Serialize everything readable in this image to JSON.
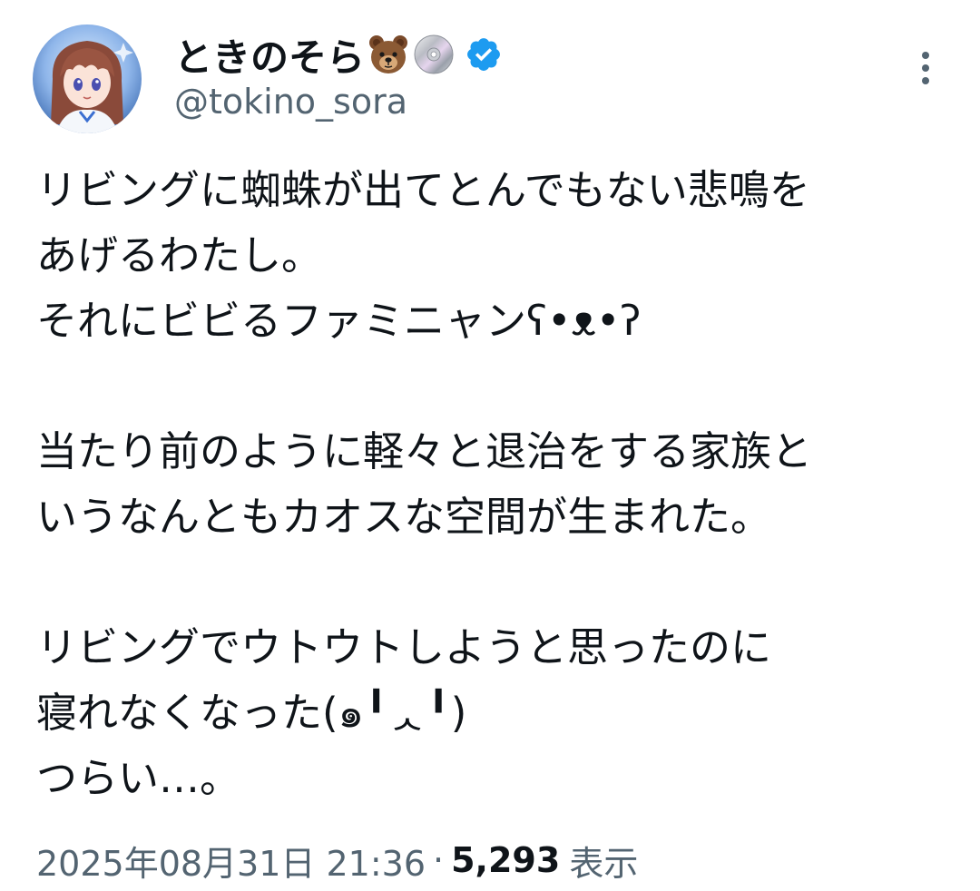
{
  "author": {
    "display_name": "ときのそら",
    "name_icons": [
      "bear-face-icon",
      "optical-disc-icon"
    ],
    "verified": true,
    "handle": "@tokino_sora"
  },
  "tweet": {
    "lines": [
      "リビングに蜘蛛が出てとんでもない悲鳴を",
      "あげるわたし。",
      "それにビビるファミニャンʕ•ᴥ•ʔ",
      "",
      "当たり前のように軽々と退治をする家族と",
      "いうなんともカオスな空間が生まれた。",
      "",
      "リビングでウトウトしようと思ったのに",
      "寝れなくなった(๑╹ᆺ╹)",
      "つらい…。"
    ]
  },
  "meta": {
    "timestamp": "2025年08月31日 21:36",
    "separator": "·",
    "views_count": "5,293",
    "views_label": "表示"
  },
  "colors": {
    "text_primary": "#0f1419",
    "text_secondary": "#536471",
    "verified_blue": "#1d9bf0"
  }
}
